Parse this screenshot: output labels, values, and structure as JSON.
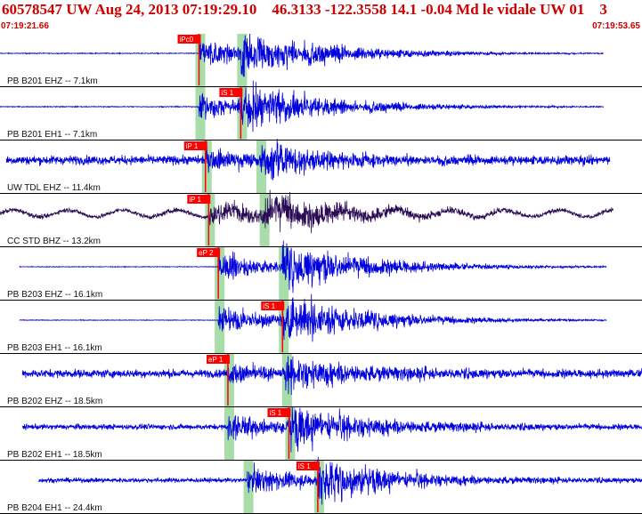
{
  "header": {
    "title": "60578547 UW Aug 24, 2013 07:19:29.10    46.3133 -122.3558 14.1 -0.04 Md le vidale UW 01    3",
    "time_start": "07:19:21.66",
    "time_end": "07:19:53.65"
  },
  "colors": {
    "trace": "#0000dd",
    "trace_alt": "#2a0a55",
    "pick": "#ff0000",
    "window": "#a8dca8",
    "grid": "#000000"
  },
  "traces": [
    {
      "label": "PB B201 EHZ -- 7.1km",
      "pick": "iPc0",
      "color_key": "trace",
      "noise": 0.05,
      "long_amp": 0,
      "long_period": 0,
      "event_strength": 1.0,
      "trace_start": 0.0,
      "trace_end": 0.94,
      "p_time": 0.31,
      "s_time": 0.375,
      "pick_time": 0.31
    },
    {
      "label": "PB B201 EH1 -- 7.1km",
      "pick": "iS 1",
      "color_key": "trace",
      "noise": 0.05,
      "long_amp": 0,
      "long_period": 0,
      "event_strength": 1.0,
      "trace_start": 0.0,
      "trace_end": 0.94,
      "p_time": 0.31,
      "s_time": 0.375,
      "pick_time": 0.375
    },
    {
      "label": "UW TDL EHZ -- 11.4km",
      "pick": "iP 1",
      "color_key": "trace",
      "noise": 0.5,
      "long_amp": 0,
      "long_period": 0,
      "event_strength": 0.8,
      "trace_start": 0.01,
      "trace_end": 0.95,
      "p_time": 0.32,
      "s_time": 0.405,
      "pick_time": 0.32
    },
    {
      "label": "CC STD BHZ -- 13.2km",
      "pick": "iP 1",
      "color_key": "trace_alt",
      "noise": 0.25,
      "long_amp": 0.55,
      "long_period": 0.085,
      "event_strength": 0.9,
      "trace_start": 0.0,
      "trace_end": 0.955,
      "p_time": 0.325,
      "s_time": 0.41,
      "pick_time": 0.325
    },
    {
      "label": "PB B203 EHZ -- 16.1km",
      "pick": "eP 2",
      "color_key": "trace",
      "noise": 0.04,
      "long_amp": 0,
      "long_period": 0,
      "event_strength": 1.0,
      "trace_start": 0.03,
      "trace_end": 0.945,
      "p_time": 0.34,
      "s_time": 0.44,
      "pick_time": 0.34
    },
    {
      "label": "PB B203 EH1 -- 16.1km",
      "pick": "iS 1",
      "color_key": "trace",
      "noise": 0.04,
      "long_amp": 0,
      "long_period": 0,
      "event_strength": 1.0,
      "trace_start": 0.03,
      "trace_end": 0.945,
      "p_time": 0.34,
      "s_time": 0.44,
      "pick_time": 0.44
    },
    {
      "label": "PB B202 EHZ -- 18.5km",
      "pick": "eP 1",
      "color_key": "trace",
      "noise": 0.45,
      "long_amp": 0,
      "long_period": 0,
      "event_strength": 0.8,
      "trace_start": 0.035,
      "trace_end": 1.0,
      "p_time": 0.355,
      "s_time": 0.445,
      "pick_time": 0.355
    },
    {
      "label": "PB B202 EH1 -- 18.5km",
      "pick": "iS 1",
      "color_key": "trace",
      "noise": 0.3,
      "long_amp": 0,
      "long_period": 0,
      "event_strength": 1.0,
      "trace_start": 0.035,
      "trace_end": 1.0,
      "p_time": 0.355,
      "s_time": 0.45,
      "pick_time": 0.45
    },
    {
      "label": "PB B204 EH1 -- 24.4km",
      "pick": "iS 1",
      "color_key": "trace",
      "noise": 0.25,
      "long_amp": 0,
      "long_period": 0,
      "event_strength": 1.0,
      "trace_start": 0.06,
      "trace_end": 1.0,
      "p_time": 0.385,
      "s_time": 0.495,
      "pick_time": 0.495
    }
  ]
}
